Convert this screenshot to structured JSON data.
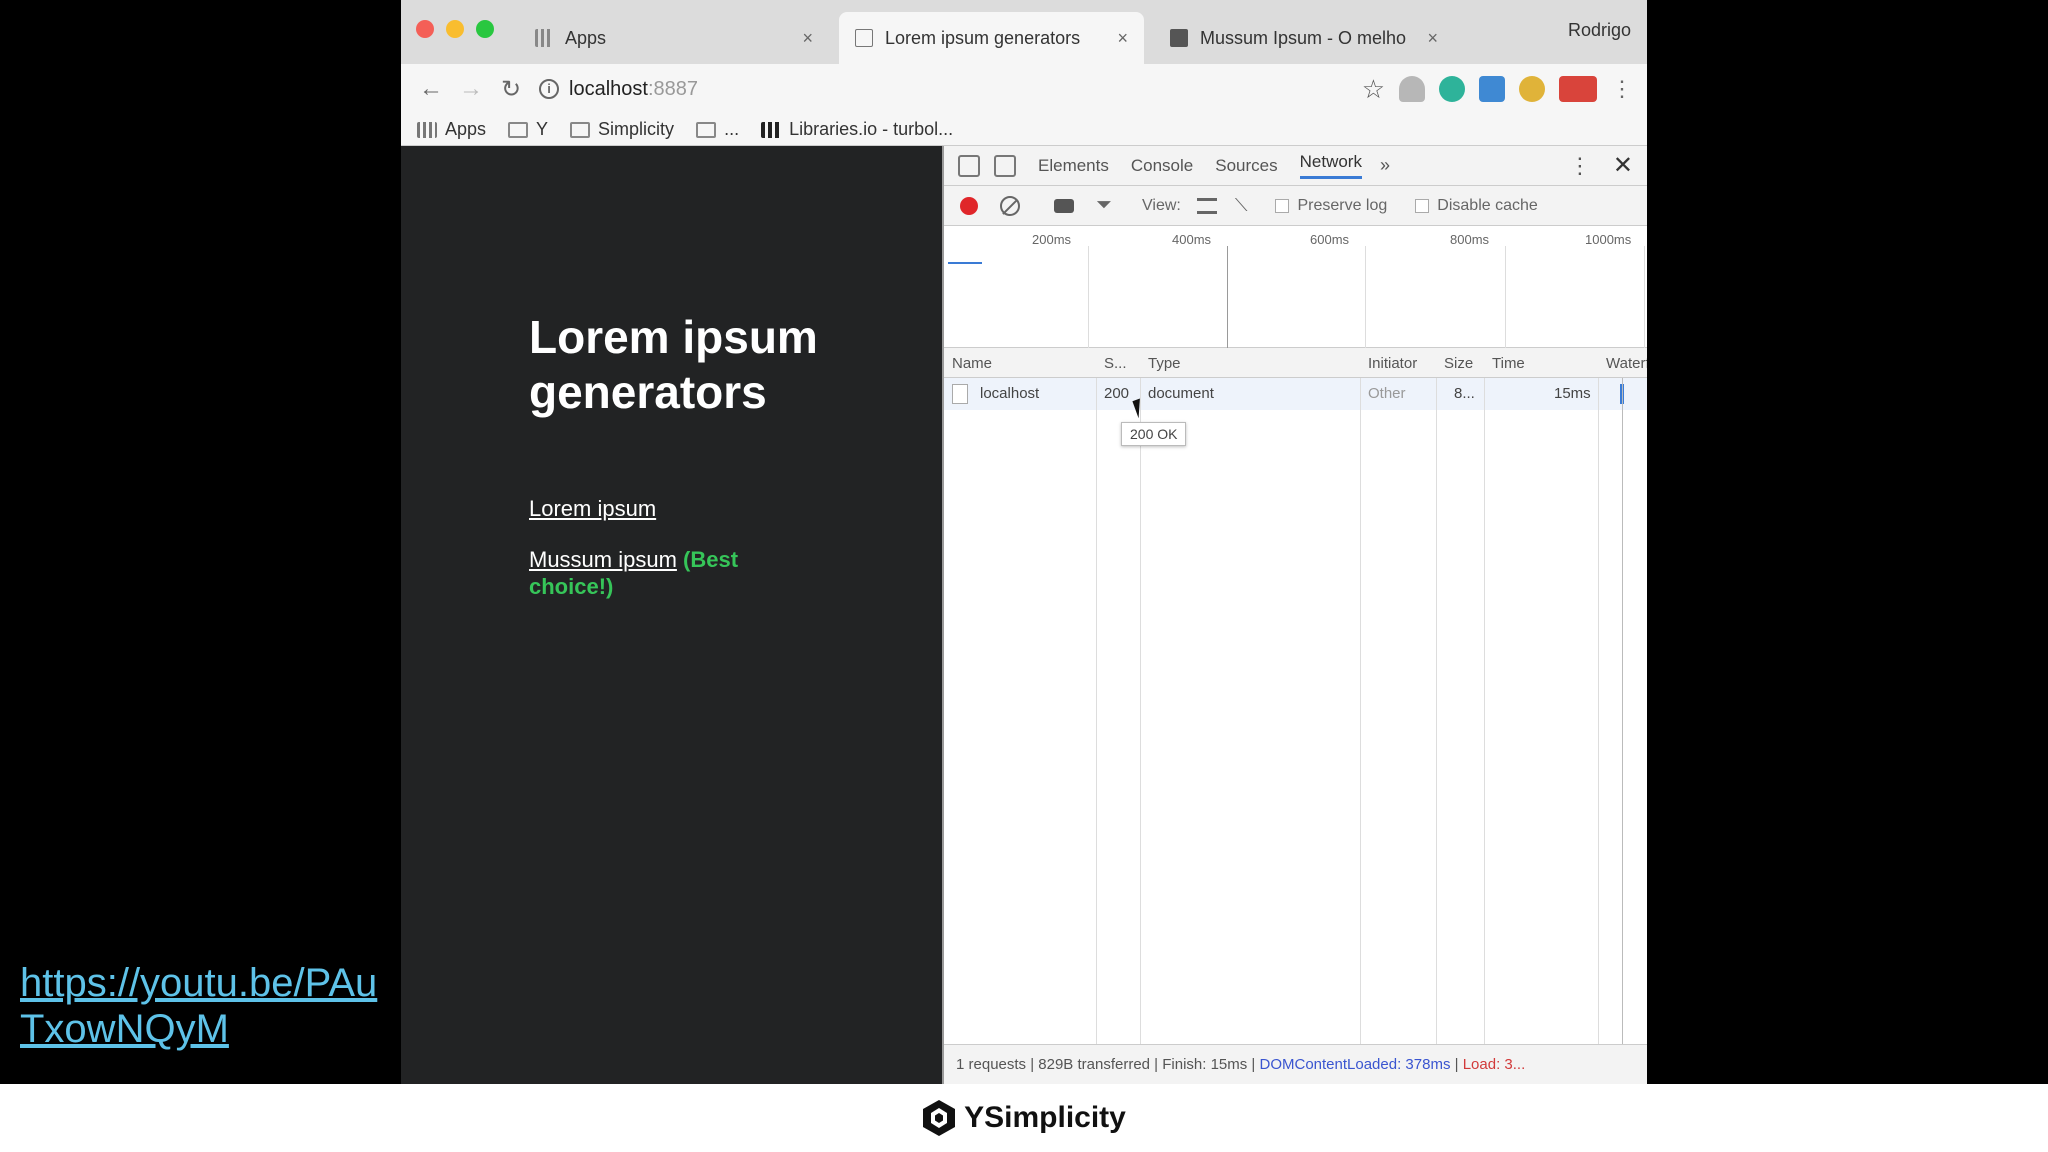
{
  "browser": {
    "tabs": [
      {
        "label": "Apps",
        "close": "×"
      },
      {
        "label": "Lorem ipsum generators",
        "close": "×"
      },
      {
        "label": "Mussum Ipsum - O melho",
        "close": "×"
      }
    ],
    "profile": "Rodrigo",
    "address": {
      "host": "localhost",
      "port": ":8887"
    },
    "bookmarks": [
      "Apps",
      "Y",
      "Simplicity",
      "...",
      "Libraries.io - turbol..."
    ]
  },
  "page": {
    "title": "Lorem ipsum generators",
    "link1": "Lorem ipsum",
    "link2": "Mussum ipsum",
    "best": "(Best choice!)"
  },
  "devtools": {
    "tabs": [
      "Elements",
      "Console",
      "Sources",
      "Network",
      "»"
    ],
    "filterbar": {
      "view": "View:",
      "preserve_log": "Preserve log",
      "disable_cache": "Disable cache"
    },
    "overview_ticks": [
      "200ms",
      "400ms",
      "600ms",
      "800ms",
      "1000ms"
    ],
    "columns": [
      "Name",
      "S...",
      "Type",
      "Initiator",
      "Size",
      "Time",
      "Waterf"
    ],
    "rows": [
      {
        "name": "localhost",
        "status": "200",
        "type": "document",
        "initiator": "Other",
        "size": "8...",
        "time": "15ms"
      }
    ],
    "tooltip": "200 OK",
    "status": {
      "summary": "1 requests | 829B transferred | Finish: 15ms |",
      "dcl": "DOMContentLoaded: 378ms",
      "sep": "|",
      "load": "Load: 3..."
    }
  },
  "overlay": {
    "youtube_url": "https://youtu.be/PAuTxowNQyM",
    "brand": "YSimplicity"
  }
}
